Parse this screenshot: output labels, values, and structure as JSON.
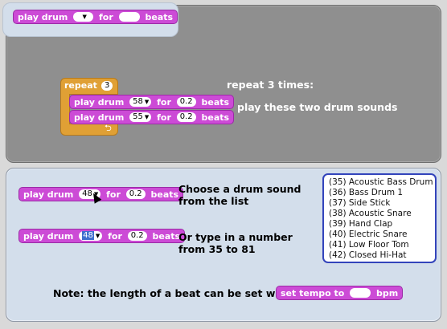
{
  "header_block": {
    "label1": "play drum",
    "label2": "for",
    "label3": "beats"
  },
  "example": {
    "repeat_label": "repeat",
    "repeat_count": "3",
    "block1": {
      "label1": "play drum",
      "drum": "58",
      "label2": "for",
      "beats": "0.2",
      "label3": "beats"
    },
    "block2": {
      "label1": "play drum",
      "drum": "55",
      "label2": "for",
      "beats": "0.2",
      "label3": "beats"
    },
    "note1": "repeat 3 times:",
    "note2": "play these two drum sounds"
  },
  "lower": {
    "block1": {
      "label1": "play drum",
      "drum": "48",
      "label2": "for",
      "beats": "0.2",
      "label3": "beats"
    },
    "block1_note": [
      "Choose a drum sound",
      "from the list"
    ],
    "block2": {
      "label1": "play drum",
      "drum": "48",
      "label2": "for",
      "beats": "0.2",
      "label3": "beats"
    },
    "block2_note": [
      "Or type in a number",
      "from 35 to 81"
    ],
    "drum_list": [
      "(35) Acoustic Bass Drum",
      "(36) Bass Drum 1",
      "(37) Side Stick",
      "(38) Acoustic Snare",
      "(39) Hand Clap",
      "(40) Electric Snare",
      "(41) Low Floor Tom",
      "(42) Closed Hi-Hat"
    ],
    "tempo_note": "Note: the length of a beat can be set with",
    "tempo_block": {
      "label1": "set tempo to",
      "label2": "bpm"
    }
  },
  "colors": {
    "sound_block": "#cc4bd6",
    "control_block": "#e0a035",
    "panel_bg": "#d3deeb",
    "work_bg": "#8f8f8f"
  }
}
